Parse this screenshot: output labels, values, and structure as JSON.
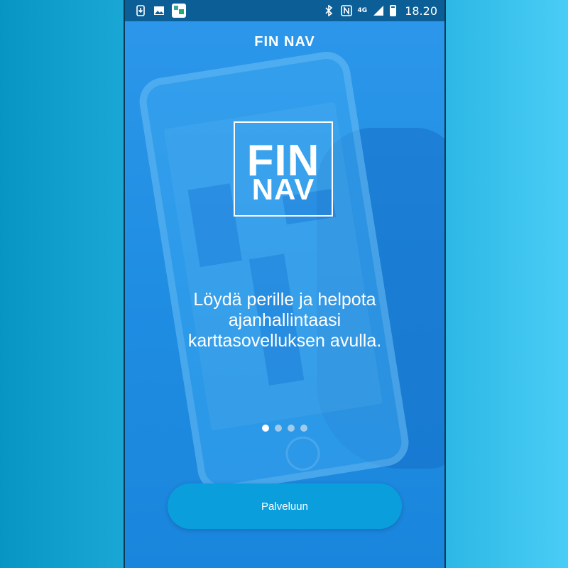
{
  "status_bar": {
    "network": "4G",
    "time": "18.20",
    "icons": [
      "download-notification-icon",
      "image-notification-icon",
      "app-notification-icon",
      "bluetooth-icon",
      "nfc-icon",
      "signal-icon",
      "battery-icon"
    ]
  },
  "header": {
    "title": "FIN NAV"
  },
  "logo": {
    "line1": "FIN",
    "line2": "NAV"
  },
  "onboarding": {
    "tagline_line1": "Löydä perille ja helpota",
    "tagline_line2": "ajanhallintaasi",
    "tagline_line3": "karttasovelluksen avulla.",
    "page_count": 4,
    "active_page": 1
  },
  "cta": {
    "label": "Palveluun"
  },
  "colors": {
    "accent": "#0a9fdc",
    "overlay": "#1f8de2",
    "status_bar": "#0c5f96"
  }
}
